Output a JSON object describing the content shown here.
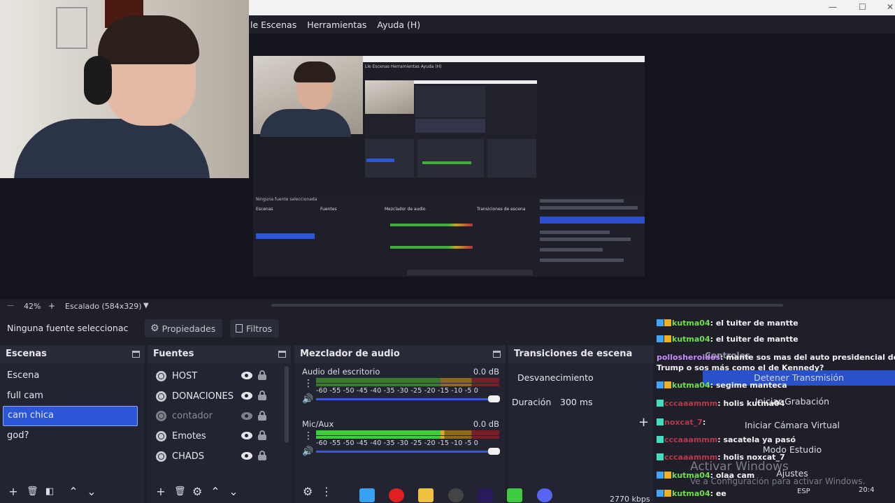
{
  "menu": {
    "items": [
      "le Escenas",
      "Herramientas",
      "Ayuda (H)"
    ]
  },
  "window_controls": {
    "minimize": "—",
    "maximize": "☐",
    "close": "✕"
  },
  "preview": {
    "zoom": "42%",
    "plus": "+",
    "scaling": "Escalado (584x329)",
    "nested_menu": "Lle Escenas   Herramientas   Ayuda (H)",
    "nested_headers": [
      "Escenas",
      "Fuentes",
      "Mezclador de audio",
      "Transiciones de escena"
    ],
    "nested_source": "Ninguna fuente seleccionada"
  },
  "source_toolbar": {
    "name": "Ninguna fuente seleccionac",
    "properties": "Propiedades",
    "filters": "Filtros"
  },
  "scenes": {
    "title": "Escenas",
    "items": [
      "Escena",
      "full cam",
      "cam chica",
      "god?"
    ],
    "selected_index": 2
  },
  "sources": {
    "title": "Fuentes",
    "items": [
      {
        "name": "HOST",
        "visible": true
      },
      {
        "name": "DONACIONES",
        "visible": true
      },
      {
        "name": "contador",
        "visible": false
      },
      {
        "name": "Emotes",
        "visible": true
      },
      {
        "name": "CHADS",
        "visible": true
      }
    ]
  },
  "mixer": {
    "title": "Mezclador de audio",
    "channels": [
      {
        "name": "Audio del escritorio",
        "db": "0.0 dB"
      },
      {
        "name": "Mic/Aux",
        "db": "0.0 dB"
      }
    ],
    "ticks": "-60 -55 -50 -45 -40 -35 -30 -25 -20 -15 -10 -5 0"
  },
  "transitions": {
    "title": "Transiciones de escena",
    "selected": "Desvanecimiento",
    "duration_label": "Duración",
    "duration_value": "300 ms",
    "plus": "+"
  },
  "controls": {
    "title": "Controles",
    "stop_stream": "Detener Transmisión",
    "start_recording": "Iniciar Grabación",
    "virtual_cam": "Iniciar Cámara Virtual",
    "studio_mode": "Modo Estudio",
    "settings": "Ajustes"
  },
  "chat": [
    {
      "user": "kutma04",
      "text": ": el tuiter de mantte",
      "color": "green"
    },
    {
      "user": "kutma04",
      "text": ": el tuiter de mantte",
      "color": "green"
    },
    {
      "user": "pollosheroidos",
      "text": ": mante sos mas del auto presidencial del",
      "color": "purple"
    },
    {
      "user": "",
      "text": "Trump o sos más como el de Kennedy?",
      "color": "none"
    },
    {
      "user": "kutma04",
      "text": ": segime manteca",
      "color": "green"
    },
    {
      "user": "cccaaammm",
      "text": ": holis kutma04",
      "color": "red"
    },
    {
      "user": "noxcat_7",
      "text": ": ",
      "color": "red"
    },
    {
      "user": "cccaaammm",
      "text": ": sacatela ya pasó",
      "color": "red"
    },
    {
      "user": "cccaaammm",
      "text": ": holis noxcat_7",
      "color": "red"
    },
    {
      "user": "kutma04",
      "text": ": olaa cam",
      "color": "green"
    },
    {
      "user": "kutma04",
      "text": ": ee",
      "color": "green"
    }
  ],
  "watermark": {
    "line1": "Activar Windows",
    "line2": "Ve a Configuración para activar Windows."
  },
  "status": {
    "bitrate": "2770 kbps",
    "lang": "ESP",
    "clock": "20:4"
  },
  "colors": {
    "accent": "#2b56d8",
    "panel": "#232431",
    "meter_green": "#3fcb3f",
    "meter_yellow": "#d6a92c",
    "meter_red": "#b8323a"
  }
}
